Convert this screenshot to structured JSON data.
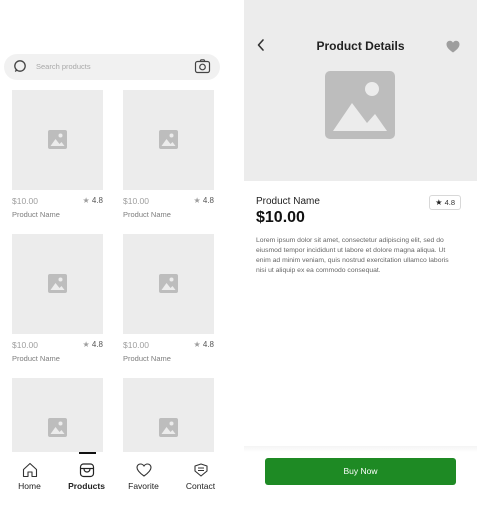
{
  "search": {
    "placeholder": "Search products"
  },
  "products": [
    {
      "price": "$10.00",
      "rating": "4.8",
      "name": "Product Name"
    },
    {
      "price": "$10.00",
      "rating": "4.8",
      "name": "Product Name"
    },
    {
      "price": "$10.00",
      "rating": "4.8",
      "name": "Product Name"
    },
    {
      "price": "$10.00",
      "rating": "4.8",
      "name": "Product Name"
    },
    {
      "price": "",
      "rating": "",
      "name": ""
    },
    {
      "price": "",
      "rating": "",
      "name": ""
    }
  ],
  "nav": {
    "items": [
      {
        "label": "Home",
        "icon": "home-icon"
      },
      {
        "label": "Products",
        "icon": "products-icon",
        "active": true
      },
      {
        "label": "Favorite",
        "icon": "heart-icon"
      },
      {
        "label": "Contact",
        "icon": "contact-icon"
      }
    ]
  },
  "detail": {
    "title": "Product Details",
    "product_name": "Product Name",
    "rating": "4.8",
    "price": "$10.00",
    "description": "Lorem ipsum dolor sit amet, consectetur adipiscing elit, sed do eiusmod tempor incididunt ut labore et dolore magna aliqua. Ut enim ad minim veniam, quis nostrud exercitation ullamco laboris nisi ut aliquip ex ea commodo consequat.",
    "buy_label": "Buy Now"
  },
  "colors": {
    "accent": "#1e8a24",
    "placeholder_bg": "#ececec"
  }
}
